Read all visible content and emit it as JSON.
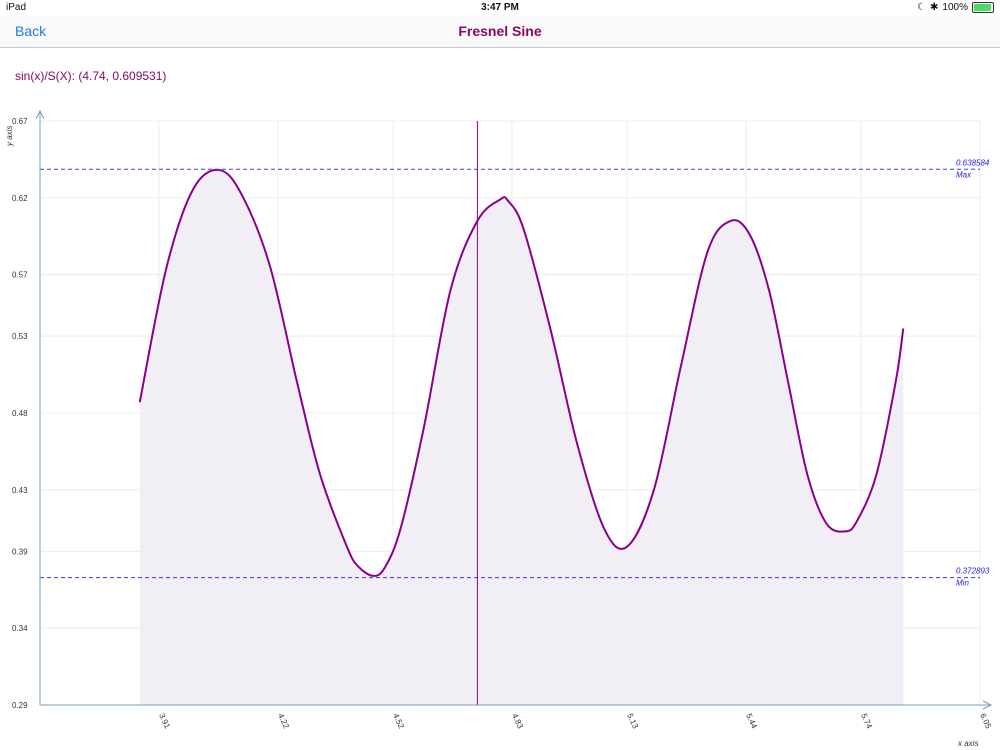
{
  "status_bar": {
    "device": "iPad",
    "time": "3:47 PM",
    "battery": "100%",
    "battery_level": 1.0
  },
  "nav": {
    "back_label": "Back",
    "title": "Fresnel Sine"
  },
  "readout": "sin(x)/S(X): (4.74, 0.609531)",
  "colors": {
    "accent": "#1a7cf3",
    "title": "#8a0a5e",
    "curve": "#8b008b",
    "fill": "#f2eef5",
    "limit_line": "#3a3aee"
  },
  "chart_data": {
    "type": "area",
    "xlabel": "x axis",
    "ylabel": "y axis",
    "xlim": [
      3.6,
      6.05
    ],
    "ylim": [
      0.29,
      0.67
    ],
    "x_ticks": [
      "3.91",
      "4.22",
      "4.52",
      "4.83",
      "5.13",
      "5.44",
      "5.74",
      "6.05"
    ],
    "y_ticks": [
      "0.29",
      "0.34",
      "0.39",
      "0.43",
      "0.48",
      "0.53",
      "0.57",
      "0.62",
      "0.67"
    ],
    "series": [
      {
        "x": [
          3.86,
          3.93,
          4.0,
          4.07,
          4.13,
          4.2,
          4.27,
          4.33,
          4.4,
          4.43,
          4.47,
          4.5,
          4.54,
          4.6,
          4.67,
          4.74,
          4.8,
          4.82,
          4.86,
          4.93,
          5.0,
          5.07,
          5.13,
          5.2,
          5.27,
          5.34,
          5.4,
          5.45,
          5.5,
          5.55,
          5.6,
          5.65,
          5.7,
          5.73,
          5.78,
          5.83,
          5.85
        ],
        "y": [
          0.487,
          0.575,
          0.626,
          0.638,
          0.62,
          0.575,
          0.5,
          0.44,
          0.393,
          0.38,
          0.374,
          0.38,
          0.405,
          0.47,
          0.56,
          0.605,
          0.619,
          0.618,
          0.6,
          0.535,
          0.46,
          0.405,
          0.393,
          0.43,
          0.51,
          0.585,
          0.605,
          0.596,
          0.56,
          0.5,
          0.44,
          0.408,
          0.403,
          0.41,
          0.44,
          0.5,
          0.535
        ]
      }
    ],
    "cursor_x": 4.74,
    "max": {
      "value": 0.638584,
      "label": "Max",
      "text": "0.638584"
    },
    "min": {
      "value": 0.372893,
      "label": "Min",
      "text": "0.372893"
    },
    "grid": true
  }
}
